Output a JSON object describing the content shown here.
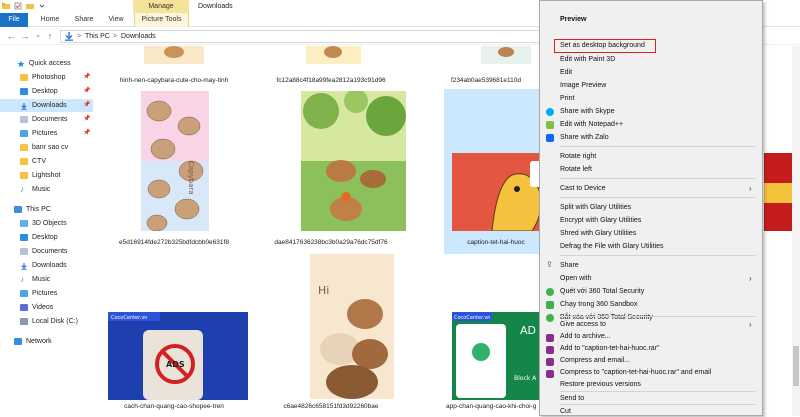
{
  "titlebar": {
    "manage_label": "Manage",
    "window_title": "Downloads"
  },
  "ribbon": {
    "tabs": {
      "file": "File",
      "home": "Home",
      "share": "Share",
      "view": "View",
      "picture_tools": "Picture Tools"
    }
  },
  "address": {
    "crumbs": [
      "This PC",
      "Downloads"
    ],
    "separator": ">"
  },
  "nav": {
    "items": [
      {
        "label": "Quick access",
        "icon": "star-icon",
        "color": "#1e90ff",
        "pinned": false,
        "selected": false
      },
      {
        "label": "Photoshop",
        "icon": "folder-icon",
        "color": "#f5c342",
        "pinned": true,
        "selected": false
      },
      {
        "label": "Desktop",
        "icon": "desktop-icon",
        "color": "#2b8fe0",
        "pinned": true,
        "selected": false
      },
      {
        "label": "Downloads",
        "icon": "download-icon",
        "color": "#2b6fd8",
        "pinned": true,
        "selected": true
      },
      {
        "label": "Documents",
        "icon": "documents-icon",
        "color": "#b8c3d0",
        "pinned": true,
        "selected": false
      },
      {
        "label": "Pictures",
        "icon": "pictures-icon",
        "color": "#4aa3e8",
        "pinned": true,
        "selected": false
      },
      {
        "label": "banr sao cv",
        "icon": "folder-icon",
        "color": "#f5c342",
        "pinned": false,
        "selected": false
      },
      {
        "label": "CTV",
        "icon": "folder-icon",
        "color": "#f5c342",
        "pinned": false,
        "selected": false
      },
      {
        "label": "Lightshot",
        "icon": "folder-icon",
        "color": "#f5c342",
        "pinned": false,
        "selected": false
      },
      {
        "label": "Music",
        "icon": "music-icon",
        "color": "#3a8de0",
        "pinned": false,
        "selected": false
      },
      {
        "label": "This PC",
        "icon": "computer-icon",
        "color": "#3a8de0",
        "pinned": false,
        "selected": false
      },
      {
        "label": "3D Objects",
        "icon": "cube-icon",
        "color": "#5ab0f0",
        "pinned": false,
        "selected": false
      },
      {
        "label": "Desktop",
        "icon": "desktop-icon",
        "color": "#2b8fe0",
        "pinned": false,
        "selected": false
      },
      {
        "label": "Documents",
        "icon": "documents-icon",
        "color": "#b8c3d0",
        "pinned": false,
        "selected": false
      },
      {
        "label": "Downloads",
        "icon": "download-icon",
        "color": "#2b6fd8",
        "pinned": false,
        "selected": false
      },
      {
        "label": "Music",
        "icon": "music-icon",
        "color": "#3a8de0",
        "pinned": false,
        "selected": false
      },
      {
        "label": "Pictures",
        "icon": "pictures-icon",
        "color": "#4aa3e8",
        "pinned": false,
        "selected": false
      },
      {
        "label": "Videos",
        "icon": "video-icon",
        "color": "#5a6ad8",
        "pinned": false,
        "selected": false
      },
      {
        "label": "Local Disk (C:)",
        "icon": "drive-icon",
        "color": "#8a9aaa",
        "pinned": false,
        "selected": false
      },
      {
        "label": "Network",
        "icon": "network-icon",
        "color": "#3a8de0",
        "pinned": false,
        "selected": false
      }
    ]
  },
  "files": [
    {
      "name": "hinh-nen-capybara-cute-cho-may-tinh"
    },
    {
      "name": "fc12a88c4f18a99fea2812a193c91d96"
    },
    {
      "name": "f234ab0ae539681e110d"
    },
    {
      "name": "e5d16914fde272b325bdfdcbb0e631f8"
    },
    {
      "name": "dae8417636238bc3b0a29a76dc75df76"
    },
    {
      "name": "caption-tet-hai-huoc"
    },
    {
      "name": "cach-chan-quang-cao-shopee-tren"
    },
    {
      "name": "c6ae4826c658151fd3d92260bae"
    },
    {
      "name": "app-chan-quang-cao-khi-choi-game"
    }
  ],
  "thumb_text": {
    "capybara_text": "Capybara",
    "hi_text": "Hi",
    "ads_text": "ADS",
    "ad_banner": "AD",
    "block_text": "Block A",
    "brand_tag": "CocoCenter.vn"
  },
  "menu": {
    "items": [
      {
        "label": "Preview",
        "bold": true,
        "icon": ""
      },
      {
        "label": "Set as desktop background",
        "icon": ""
      },
      {
        "label": "Edit with Paint 3D",
        "icon": ""
      },
      {
        "label": "Edit",
        "icon": ""
      },
      {
        "label": "Image Preview",
        "icon": ""
      },
      {
        "label": "Print",
        "icon": ""
      },
      {
        "label": "Share with Skype",
        "icon": "skype-icon",
        "color": "#00aff0"
      },
      {
        "label": "Edit with Notepad++",
        "icon": "notepad-plus-icon",
        "color": "#7cc142"
      },
      {
        "label": "Share with Zalo",
        "icon": "zalo-icon",
        "color": "#0a68ff"
      },
      {
        "label": "Rotate right",
        "icon": ""
      },
      {
        "label": "Rotate left",
        "icon": ""
      },
      {
        "label": "Cast to Device",
        "icon": "",
        "arrow": true
      },
      {
        "label": "Split with Glary Utilities",
        "icon": ""
      },
      {
        "label": "Encrypt with Glary Utilities",
        "icon": ""
      },
      {
        "label": "Shred with Glary Utilities",
        "icon": ""
      },
      {
        "label": "Defrag the File with Glary Utilities",
        "icon": ""
      },
      {
        "label": "Share",
        "icon": "share-icon",
        "color": "#444444"
      },
      {
        "label": "Open with",
        "icon": "",
        "arrow": true
      },
      {
        "label": "Quét với 360 Total Security",
        "icon": "shield-360-icon",
        "color": "#3cb44b"
      },
      {
        "label": "Chạy trong 360 Sandbox",
        "icon": "sandbox-360-icon",
        "color": "#3cb44b"
      },
      {
        "label": "Bắt xóa với 360 Total Security",
        "icon": "shield-360-icon",
        "color": "#3cb44b"
      },
      {
        "label": "Give access to",
        "icon": "",
        "arrow": true
      },
      {
        "label": "Add to archive...",
        "icon": "winrar-icon",
        "color": "#8b2f8f"
      },
      {
        "label": "Add to \"caption-tet-hai-huoc.rar\"",
        "icon": "winrar-icon",
        "color": "#8b2f8f"
      },
      {
        "label": "Compress and email...",
        "icon": "winrar-icon",
        "color": "#8b2f8f"
      },
      {
        "label": "Compress to \"caption-tet-hai-huoc.rar\" and email",
        "icon": "winrar-icon",
        "color": "#8b2f8f"
      },
      {
        "label": "Restore previous versions",
        "icon": ""
      },
      {
        "label": "Send to",
        "icon": "",
        "arrow": true
      },
      {
        "label": "Cut",
        "icon": ""
      }
    ],
    "highlight_color": "#e0201a",
    "arrow_glyph": "›"
  },
  "colors": {
    "accent": "#1a73c8",
    "selection": "#cce8ff",
    "manage": "#f6e39a"
  }
}
